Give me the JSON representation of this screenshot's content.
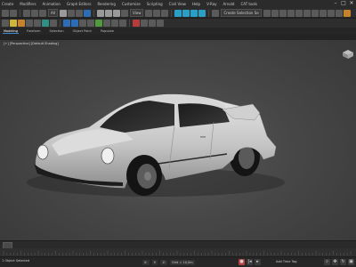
{
  "menubar": {
    "items": [
      "Create",
      "Modifiers",
      "Animation",
      "Graph Editors",
      "Rendering",
      "Customize",
      "Scripting",
      "Civil View",
      "Help",
      "V-Ray",
      "Arnold",
      "CAT tools"
    ]
  },
  "window": {
    "minimize": "–",
    "maximize": "□",
    "close": "✕"
  },
  "toolbar": {
    "selection_filter": "All",
    "view_dropdown": "View",
    "selection_set": "Create Selection Se"
  },
  "ribbon": {
    "tabs": [
      "Modeling",
      "Freeform",
      "Selection",
      "Object Paint",
      "Populate"
    ],
    "active_tab": "Modeling"
  },
  "viewport": {
    "label": "[+] [Perspective] [Default Shading]",
    "car_color": "#c9c9c9"
  },
  "timeline": {
    "position": "0 / 100"
  },
  "status": {
    "text": "1 Object Selected",
    "x_label": "X:",
    "y_label": "Y:",
    "z_label": "Z:",
    "grid": "Grid = 10,0m",
    "add_time_tag": "Add Time Tag",
    "auto_key": "Auto"
  }
}
